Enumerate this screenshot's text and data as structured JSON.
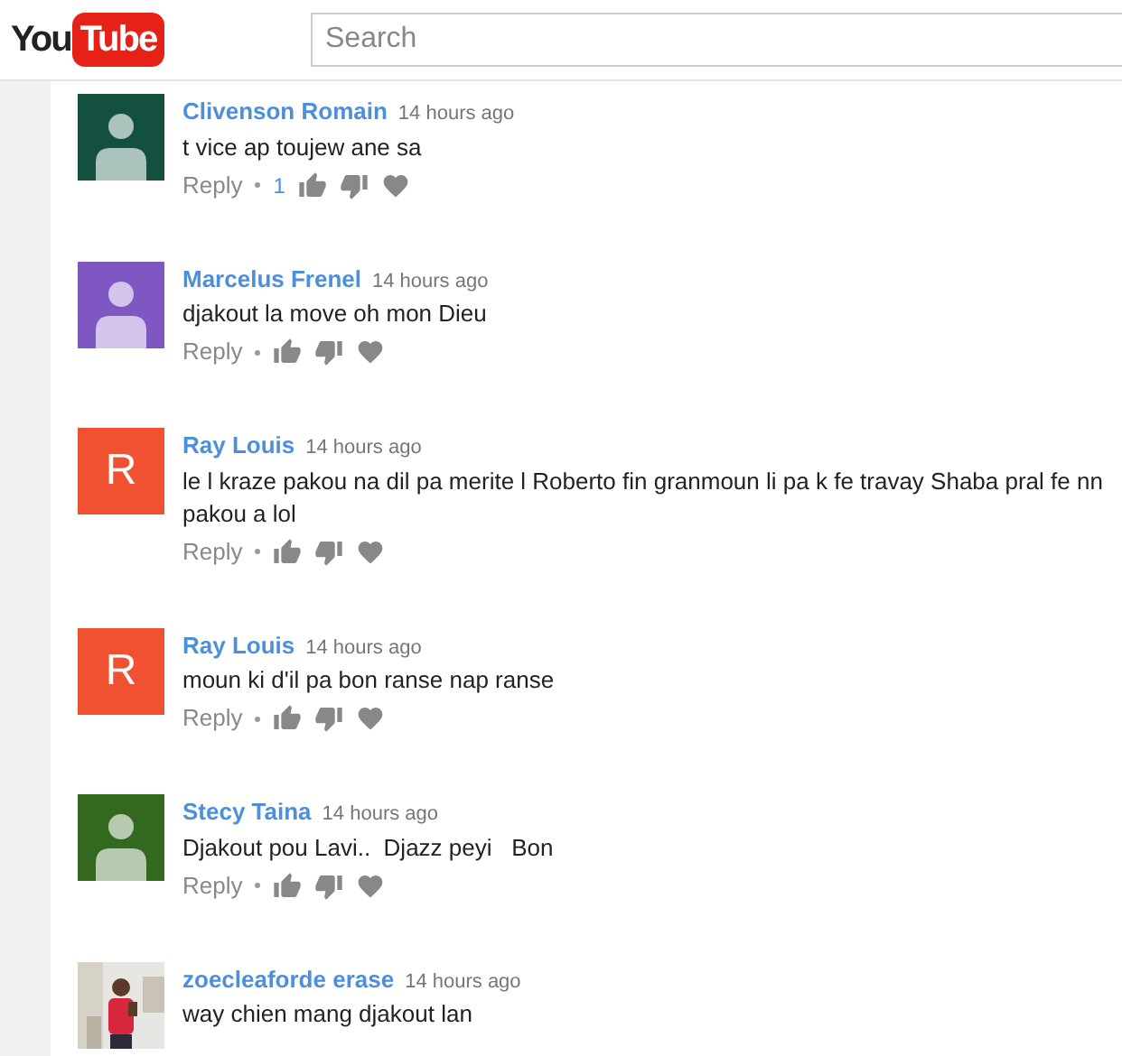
{
  "header": {
    "logo": {
      "left": "You",
      "right": "Tube"
    },
    "search": {
      "placeholder": "Search"
    }
  },
  "comments": [
    {
      "author": "Clivenson Romain",
      "time": "14 hours ago",
      "text": "t vice ap toujew ane sa",
      "avatar": {
        "kind": "silhouette",
        "color": "#13503f"
      },
      "reply": "Reply",
      "likes": "1"
    },
    {
      "author": "Marcelus Frenel",
      "time": "14 hours ago",
      "text": "djakout la move oh mon Dieu",
      "avatar": {
        "kind": "silhouette",
        "color": "#7e57c2"
      },
      "reply": "Reply"
    },
    {
      "author": "Ray Louis",
      "time": "14 hours ago",
      "text": "le l kraze pakou na dil pa merite l Roberto fin granmoun li pa k fe travay Shaba pral fe nn pakou a lol",
      "avatar": {
        "kind": "letter",
        "color": "#ef5131",
        "letter": "R"
      },
      "reply": "Reply"
    },
    {
      "author": "Ray Louis",
      "time": "14 hours ago",
      "text": "moun ki d'il pa bon ranse nap ranse",
      "avatar": {
        "kind": "letter",
        "color": "#ef5131",
        "letter": "R"
      },
      "reply": "Reply"
    },
    {
      "author": "Stecy Taina",
      "time": "14 hours ago",
      "text": "Djakout pou Lavi..  Djazz peyi   Bon",
      "avatar": {
        "kind": "silhouette",
        "color": "#33691e"
      },
      "reply": "Reply"
    },
    {
      "author": "zoecleaforde erase",
      "time": "14 hours ago",
      "text": "way chien mang djakout lan"
    }
  ]
}
